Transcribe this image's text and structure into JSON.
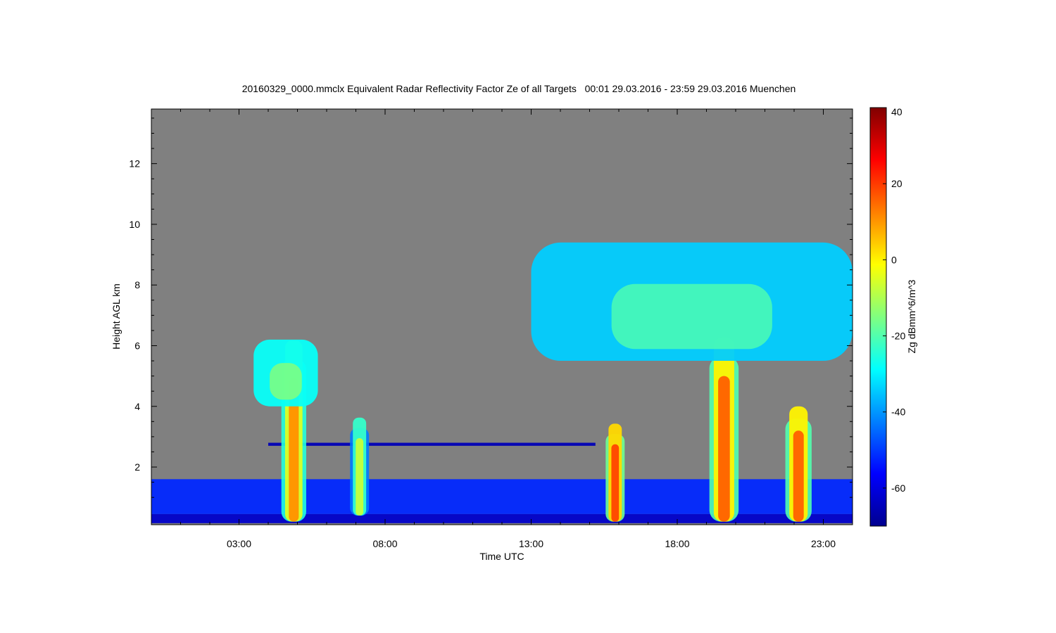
{
  "chart_data": {
    "type": "heatmap",
    "title": "20160329_0000.mmclx Equivalent Radar Reflectivity Factor Ze of all Targets   00:01 29.03.2016 - 23:59 29.03.2016 Muenchen",
    "xlabel": "Time UTC",
    "ylabel": "Height AGL km",
    "xlim": [
      0.0,
      24.0
    ],
    "ylim": [
      0.1,
      13.8
    ],
    "x_ticks": [
      {
        "value": 3,
        "label": "03:00"
      },
      {
        "value": 8,
        "label": "08:00"
      },
      {
        "value": 13,
        "label": "13:00"
      },
      {
        "value": 18,
        "label": "18:00"
      },
      {
        "value": 23,
        "label": "23:00"
      }
    ],
    "y_ticks": [
      {
        "value": 2,
        "label": "2"
      },
      {
        "value": 4,
        "label": "4"
      },
      {
        "value": 6,
        "label": "6"
      },
      {
        "value": 8,
        "label": "8"
      },
      {
        "value": 10,
        "label": "10"
      },
      {
        "value": 12,
        "label": "12"
      }
    ],
    "background_color": "#808080",
    "colorbar": {
      "label": "Zg dBmm^6/m^3",
      "range": [
        -70,
        40
      ],
      "ticks": [
        {
          "value": 40,
          "label": "40"
        },
        {
          "value": 20,
          "label": "20"
        },
        {
          "value": 0,
          "label": "0"
        },
        {
          "value": -20,
          "label": "-20"
        },
        {
          "value": -40,
          "label": "-40"
        },
        {
          "value": -60,
          "label": "-60"
        }
      ],
      "colormap": "jet"
    },
    "features": [
      {
        "name": "near-surface clutter band",
        "t0": 0.0,
        "t1": 24.0,
        "z0": 0.15,
        "z1": 0.45,
        "dbz": -62
      },
      {
        "name": "low echo layer",
        "t0": 0.0,
        "t1": 24.0,
        "z0": 0.45,
        "z1": 1.6,
        "dbz": -52
      },
      {
        "name": "echo line 2.7 km",
        "t0": 4.0,
        "t1": 15.2,
        "z0": 2.7,
        "z1": 2.8,
        "dbz": -64
      },
      {
        "name": "shower 04:30",
        "t0": 4.45,
        "t1": 5.3,
        "z0": 0.2,
        "z1": 6.5,
        "dbz": 10
      },
      {
        "name": "shower 07:10",
        "t0": 6.8,
        "t1": 7.45,
        "z0": 0.4,
        "z1": 3.8,
        "dbz": -8
      },
      {
        "name": "shower 15:50",
        "t0": 15.55,
        "t1": 16.2,
        "z0": 0.2,
        "z1": 3.6,
        "dbz": 18
      },
      {
        "name": "shower 19:30",
        "t0": 19.1,
        "t1": 20.1,
        "z0": 0.2,
        "z1": 6.6,
        "dbz": 15
      },
      {
        "name": "shower 22:00",
        "t0": 21.7,
        "t1": 22.6,
        "z0": 0.2,
        "z1": 4.2,
        "dbz": 15
      },
      {
        "name": "mid-level cloud 03:30",
        "t0": 3.5,
        "t1": 5.7,
        "z0": 4.0,
        "z1": 6.2,
        "dbz": -28
      },
      {
        "name": "upper cloud deck",
        "t0": 13.0,
        "t1": 24.0,
        "z0": 5.5,
        "z1": 9.4,
        "dbz": -34
      }
    ]
  }
}
